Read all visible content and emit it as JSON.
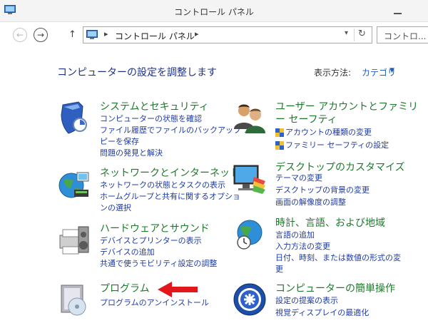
{
  "window": {
    "title": "コントロール パネル"
  },
  "address": {
    "crumb": "コントロール パネル",
    "sep": "▸",
    "search_placeholder": "コントロ..."
  },
  "nav": {
    "back": "←",
    "forward": "→",
    "up": "↑",
    "dropdown": "▾",
    "refresh": "↻"
  },
  "main": {
    "heading": "コンピューターの設定を調整します",
    "view_by_label": "表示方法:",
    "view_by_value": "カテゴリ",
    "view_by_caret": "▼"
  },
  "categories": {
    "system": {
      "title": "システムとセキュリティ",
      "links": [
        "コンピューターの状態を確認",
        "ファイル履歴でファイルのバックアップ コ",
        "ピーを保存",
        "問題の発見と解決"
      ]
    },
    "network": {
      "title": "ネットワークとインターネット",
      "links": [
        "ネットワークの状態とタスクの表示",
        "ホームグループと共有に関するオプショ",
        "ンの選択"
      ]
    },
    "hardware": {
      "title": "ハードウェアとサウンド",
      "links": [
        "デバイスとプリンターの表示",
        "デバイスの追加",
        "共通で使うモビリティ設定の調整"
      ]
    },
    "programs": {
      "title": "プログラム",
      "links": [
        "プログラムのアンインストール"
      ]
    },
    "users": {
      "title_line1": "ユーザー アカウントとファミリ",
      "title_line2": "ー セーフティ",
      "links": [
        "アカウントの種類の変更",
        "ファミリー セーフティの設定"
      ]
    },
    "appearance": {
      "title": "デスクトップのカスタマイズ",
      "links": [
        "テーマの変更",
        "デスクトップの背景の変更",
        "画面の解像度の調整"
      ]
    },
    "clock": {
      "title": "時計、言語、および地域",
      "links": [
        "言語の追加",
        "入力方法の変更",
        "日付、時刻、または数値の形式の変",
        "更"
      ]
    },
    "ease": {
      "title": "コンピューターの簡単操作",
      "links": [
        "設定の提案の表示",
        "視覚ディスプレイの最適化"
      ]
    }
  },
  "colors": {
    "heading": "#1e3287",
    "category_title": "#1d7a2a",
    "link": "#1f3ba3",
    "arrow": "#e3161b"
  }
}
